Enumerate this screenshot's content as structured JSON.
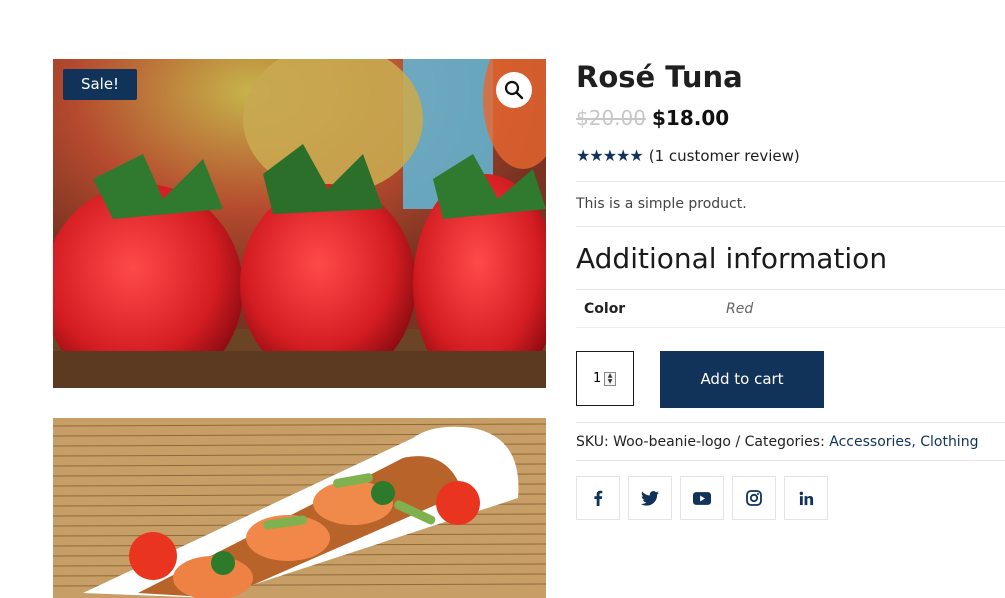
{
  "gallery": {
    "sale_badge": "Sale!"
  },
  "product": {
    "title": "Rosé Tuna",
    "old_price": "$20.00",
    "new_price": "$18.00",
    "rating_stars": "★★★★★",
    "rating_value": 5,
    "review_text": "(1 customer review)",
    "description": "This is a simple product."
  },
  "additional_info": {
    "heading": "Additional information",
    "attributes": [
      {
        "label": "Color",
        "value": "Red"
      }
    ]
  },
  "purchase": {
    "quantity": "1",
    "add_to_cart_label": "Add to cart"
  },
  "meta": {
    "sku_label": "SKU:",
    "sku": "Woo-beanie-logo",
    "separator": "/",
    "categories_label": "Categories:",
    "categories": [
      "Accessories",
      "Clothing"
    ],
    "category_separator": ","
  },
  "social": [
    {
      "icon": "facebook-icon",
      "glyph": "f"
    },
    {
      "icon": "twitter-icon",
      "glyph": "bird"
    },
    {
      "icon": "youtube-icon",
      "glyph": "play"
    },
    {
      "icon": "instagram-icon",
      "glyph": "camera"
    },
    {
      "icon": "linkedin-icon",
      "glyph": "in"
    }
  ],
  "colors": {
    "accent": "#113359",
    "sale_badge_bg": "#113359",
    "old_price": "#c7c7c7",
    "strawberry_red": "#d81f25"
  }
}
